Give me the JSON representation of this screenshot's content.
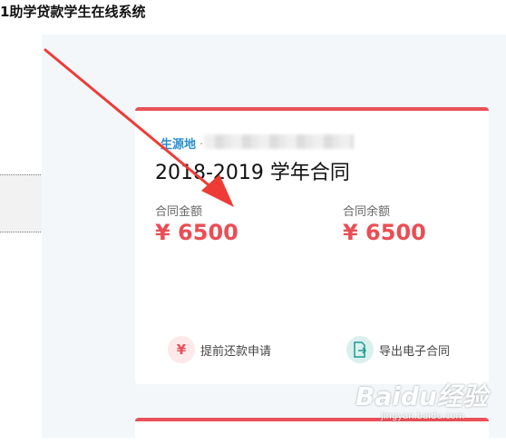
{
  "header": {
    "title": "1助学贷款学生在线系统"
  },
  "card": {
    "origin_label": "生源地",
    "origin_separator": "·",
    "contract_title": "2018-2019 学年合同",
    "contract_amount_label": "合同金额",
    "contract_amount_value": "¥ 6500",
    "balance_label": "合同余额",
    "balance_value": "¥ 6500",
    "actions": [
      {
        "icon": "yen-icon",
        "icon_glyph": "¥",
        "label": "提前还款申请"
      },
      {
        "icon": "export-document-icon",
        "label": "导出电子合同"
      }
    ]
  },
  "watermark": {
    "logo": "Baidu经验",
    "sub": "jingyan.baidu.com"
  },
  "colors": {
    "accent_red": "#e9515a",
    "link_blue": "#2a8fd0",
    "content_bg": "#f3f7fa",
    "teal": "#1f9a90",
    "arrow_red": "#ee3b35"
  }
}
